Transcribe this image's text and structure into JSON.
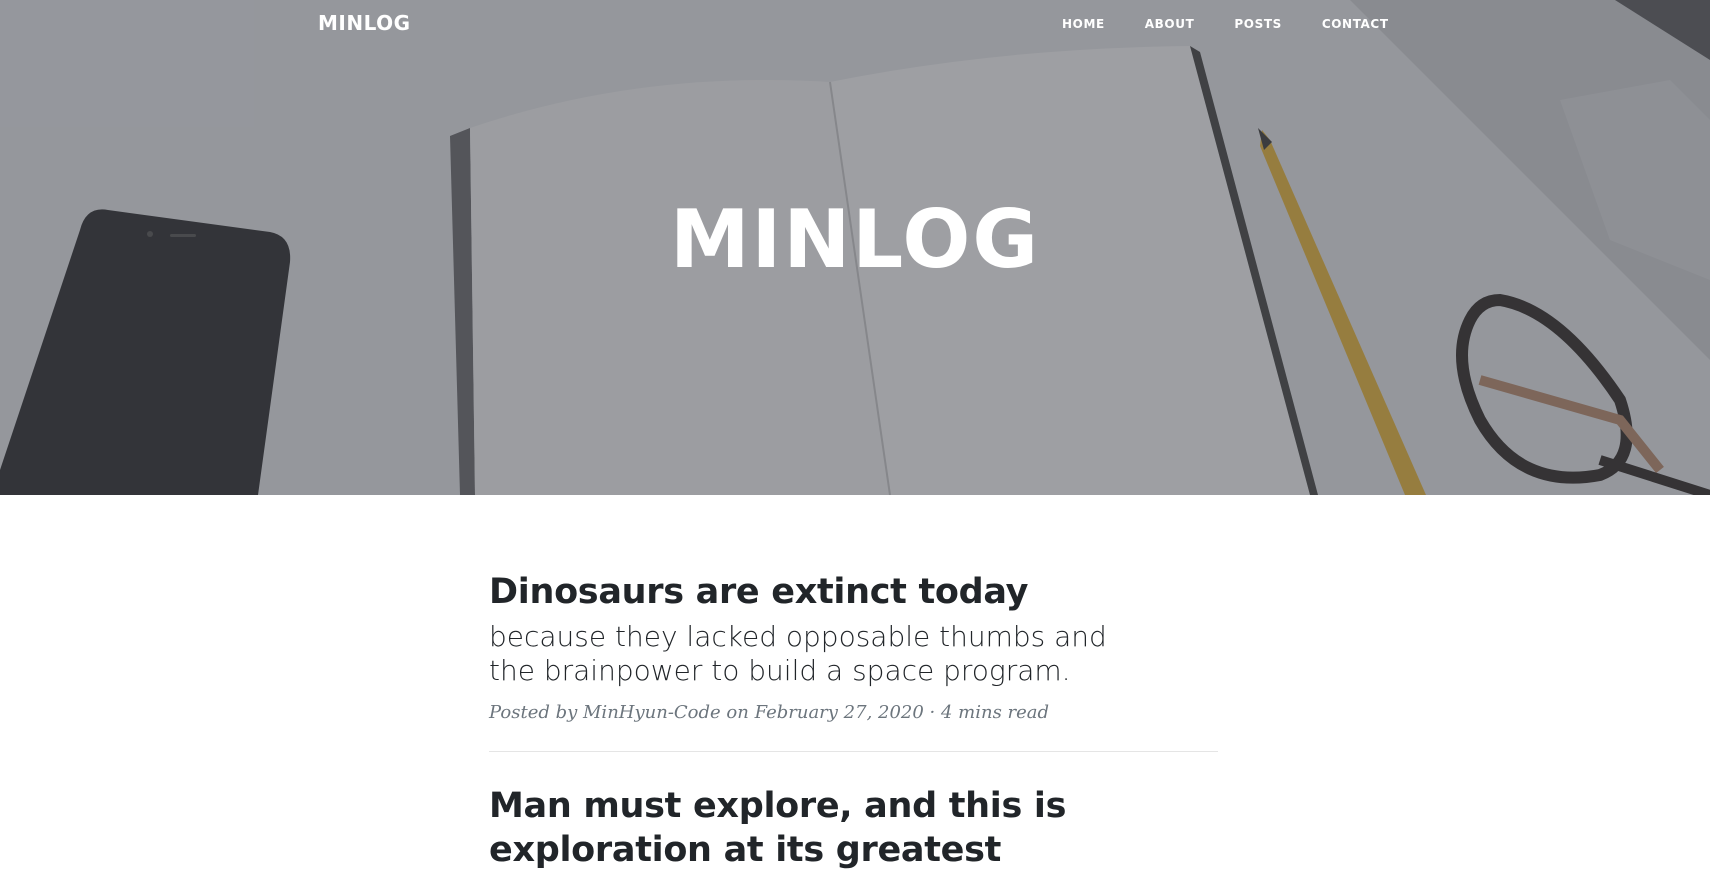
{
  "nav": {
    "brand": "MINLOG",
    "links": [
      "HOME",
      "ABOUT",
      "POSTS",
      "CONTACT"
    ]
  },
  "hero": {
    "title": "MINLOG"
  },
  "posts": [
    {
      "title": "Dinosaurs are extinct today",
      "subtitle": "because they lacked opposable thumbs and the brainpower to build a space program.",
      "meta_prefix": "Posted by ",
      "author": "MinHyun-Code",
      "meta_date": " on February 27, 2020 · 4 mins read"
    },
    {
      "title": "Man must explore, and this is exploration at its greatest"
    }
  ]
}
